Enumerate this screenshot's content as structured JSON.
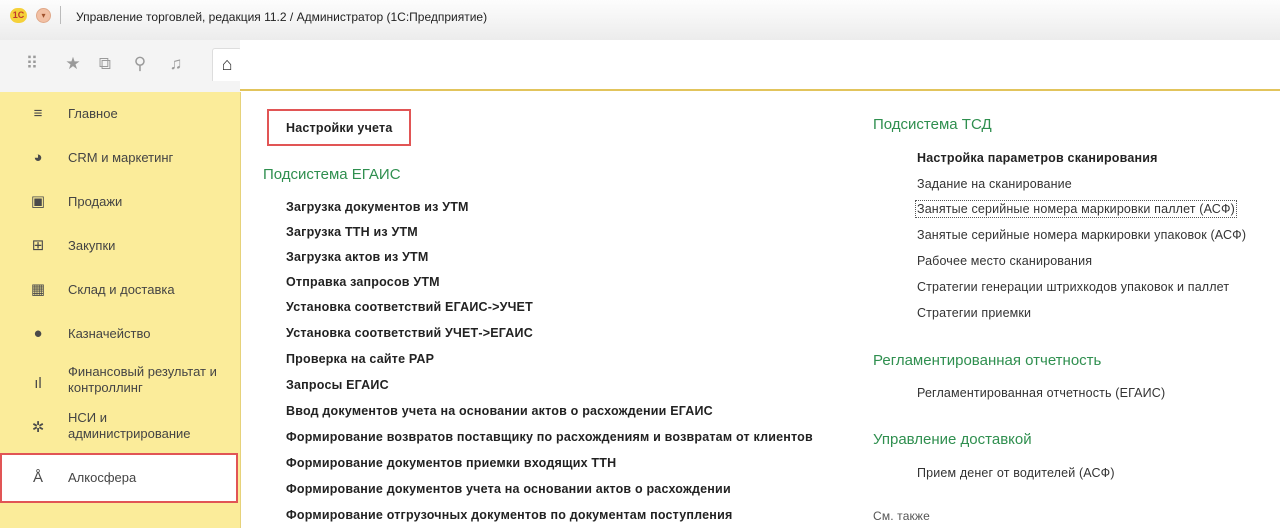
{
  "window": {
    "title": "Управление торговлей, редакция 11.2 / Администратор  (1С:Предприятие)",
    "logo_text": "1С"
  },
  "toolbar": {
    "icons": [
      "apps-icon",
      "star-icon",
      "history-icon",
      "search-icon",
      "bell-icon",
      "home-icon"
    ]
  },
  "sidebar": {
    "items": [
      {
        "label": "Главное",
        "icon": "menu-lines-icon"
      },
      {
        "label": "CRM и маркетинг",
        "icon": "pie-chart-icon"
      },
      {
        "label": "Продажи",
        "icon": "shopping-bag-icon"
      },
      {
        "label": "Закупки",
        "icon": "cart-icon"
      },
      {
        "label": "Склад и доставка",
        "icon": "warehouse-icon"
      },
      {
        "label": "Казначейство",
        "icon": "coin-icon"
      },
      {
        "label": "Финансовый результат и контроллинг",
        "icon": "bar-chart-icon"
      },
      {
        "label": "НСИ и администрирование",
        "icon": "gear-icon"
      },
      {
        "label": "Алкосфера",
        "icon": "bottle-icon"
      }
    ]
  },
  "main": {
    "top_link": "Настройки учета",
    "egais": {
      "heading": "Подсистема ЕГАИС",
      "links": [
        "Загрузка документов из УТМ",
        "Загрузка ТТН из УТМ",
        "Загрузка актов из УТМ",
        "Отправка запросов УТМ",
        "Установка соответствий ЕГАИС->УЧЕТ",
        "Установка соответствий УЧЕТ->ЕГАИС",
        "Проверка на сайте РАР",
        "Запросы ЕГАИС",
        "Ввод документов учета на основании актов о расхождении ЕГАИС",
        "Формирование возвратов поставщику по расхождениям и возвратам от клиентов",
        "Формирование документов приемки входящих ТТН",
        "Формирование документов учета на основании актов о расхождении",
        "Формирование отгрузочных документов по документам поступления"
      ]
    },
    "tsd": {
      "heading": "Подсистема ТСД",
      "bold_link": "Настройка параметров сканирования",
      "links": [
        "Задание на сканирование",
        "Занятые серийные номера маркировки паллет (АСФ)",
        "Занятые серийные номера маркировки упаковок (АСФ)",
        "Рабочее место сканирования",
        "Стратегии генерации штрихкодов упаковок и паллет",
        "Стратегии приемки"
      ]
    },
    "reports": {
      "heading": "Регламентированная отчетность",
      "links": [
        "Регламентированная отчетность (ЕГАИС)"
      ]
    },
    "delivery": {
      "heading": "Управление доставкой",
      "links": [
        "Прием денег от водителей (АСФ)"
      ]
    },
    "see_also": "См. также"
  }
}
